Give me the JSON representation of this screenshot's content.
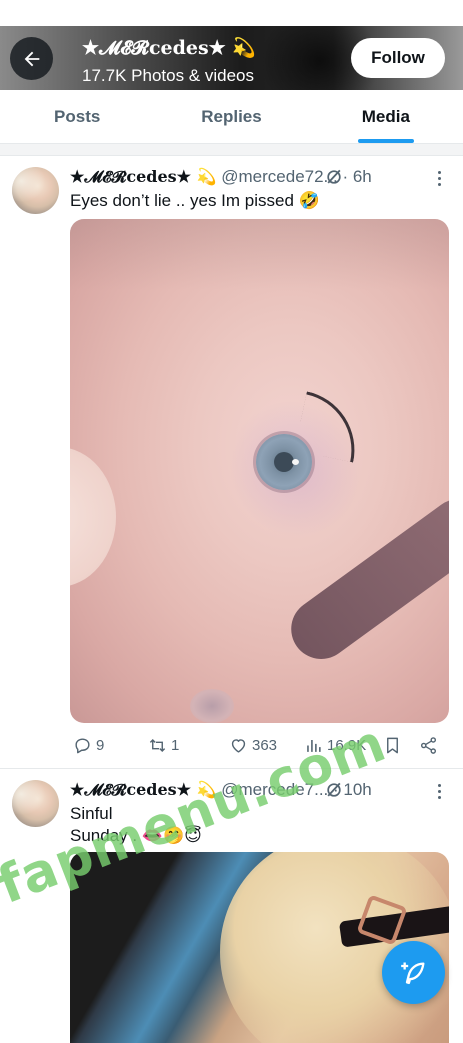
{
  "header": {
    "title": "★𝓜𝓔𝓡cedes★ 💫",
    "subtitle": "17.7K Photos & videos",
    "follow_label": "Follow"
  },
  "tabs": [
    {
      "label": "Posts",
      "active": false
    },
    {
      "label": "Replies",
      "active": false
    },
    {
      "label": "Media",
      "active": true
    }
  ],
  "posts": [
    {
      "name": "★𝓜𝓔𝓡cedes★ 💫",
      "handle": "@mercede72...",
      "time": "· 6h",
      "text": "Eyes don’t lie .. yes Im pissed 🤣",
      "replies": "9",
      "reposts": "1",
      "likes": "363",
      "views": "16.9K"
    },
    {
      "name": "★𝓜𝓔𝓡cedes★ 💫",
      "handle": "@mercede7...",
      "time": "· 10h",
      "text": "Sinful\nSunday . 👄🤭😇"
    }
  ],
  "watermark": "fapmenu.com",
  "icons": {
    "back": "arrow-left-icon",
    "grok": "grok-icon",
    "more": "more-vertical-icon",
    "reply": "reply-icon",
    "repost": "repost-icon",
    "like": "heart-icon",
    "views": "views-icon",
    "bookmark": "bookmark-icon",
    "share": "share-icon",
    "compose": "compose-icon"
  },
  "colors": {
    "accent": "#1d9bf0",
    "secondary_text": "#536471",
    "watermark": "#78cd6e"
  }
}
